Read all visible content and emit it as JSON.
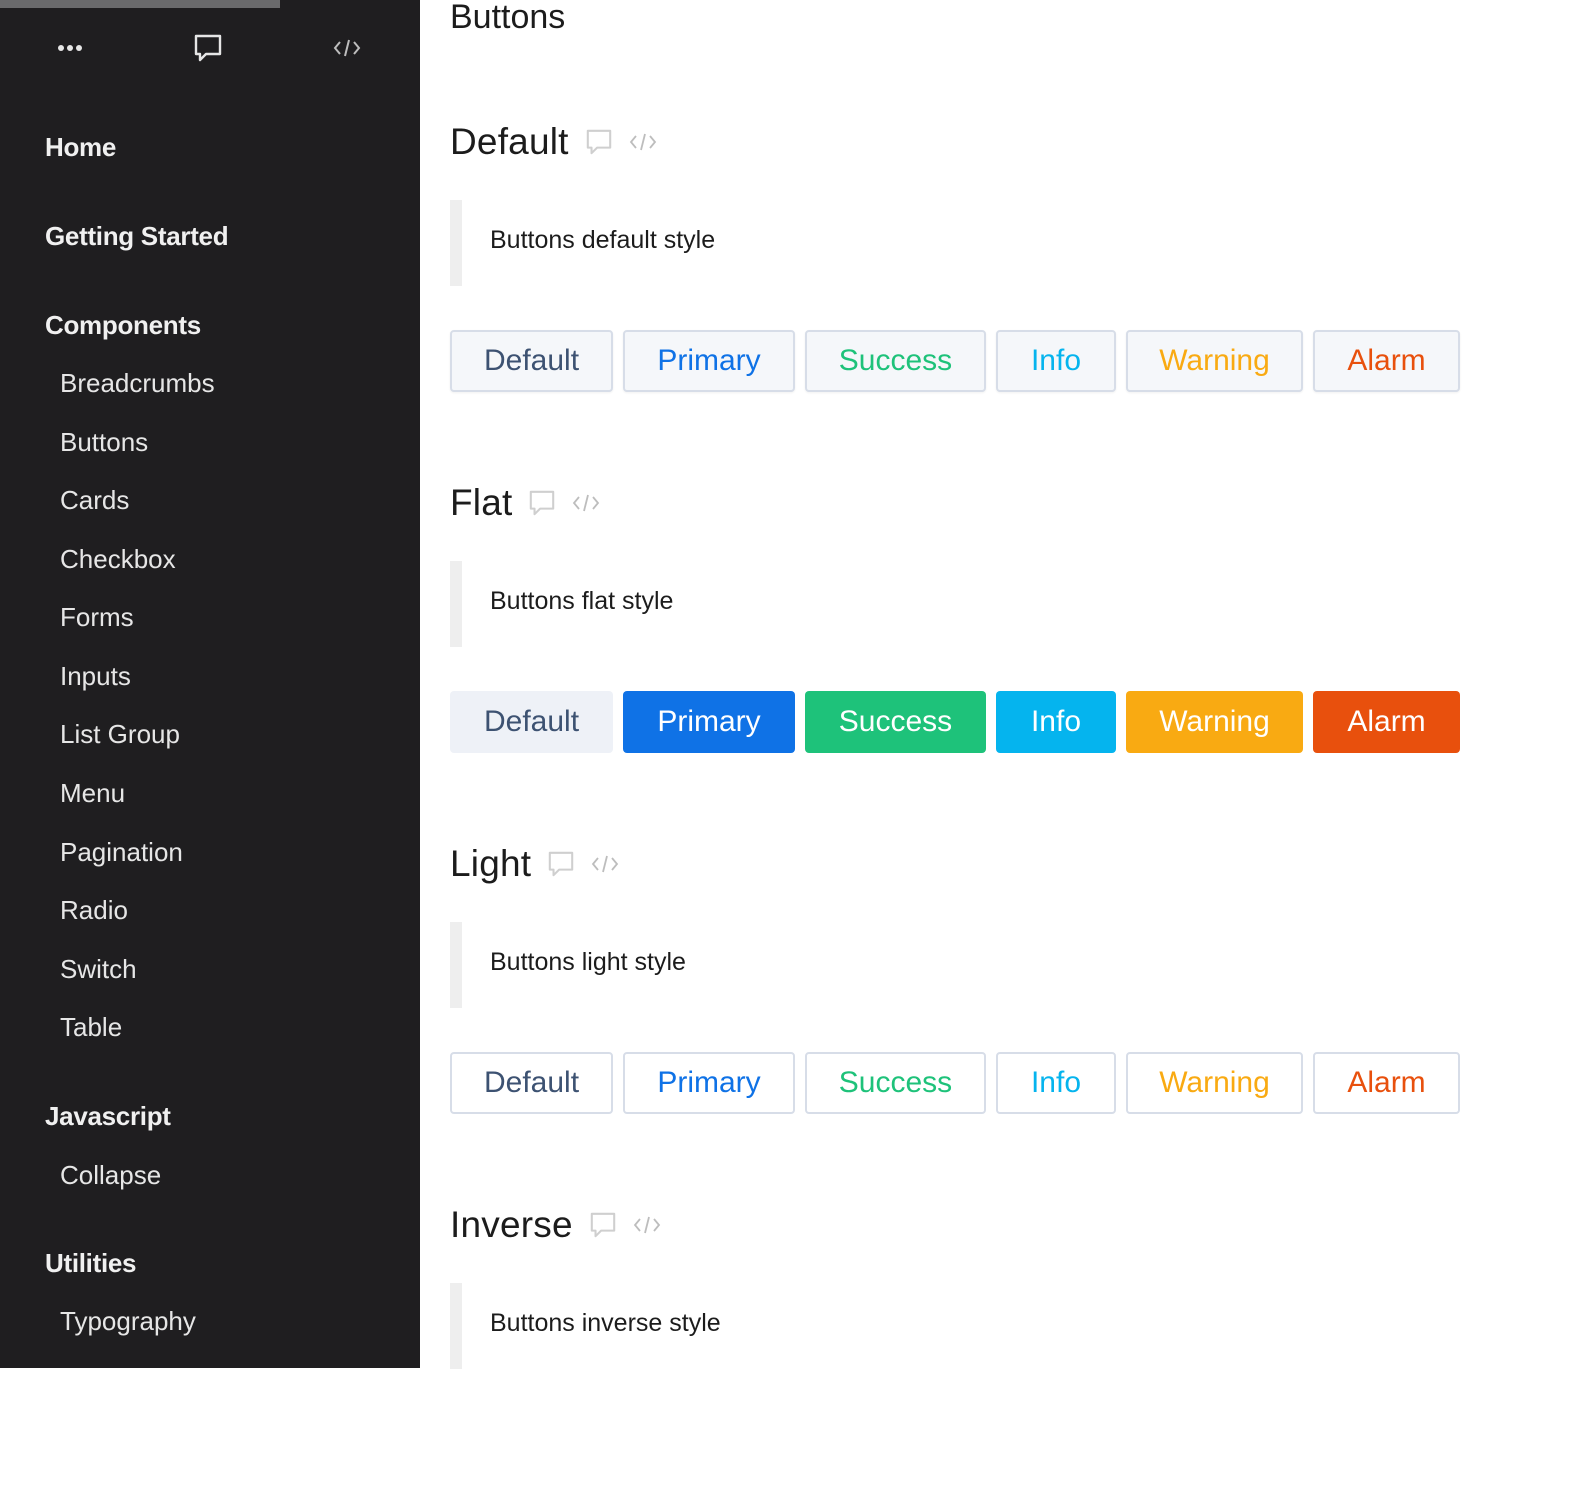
{
  "sidebar": {
    "toolbar": {
      "more_icon": "more-horizontal-icon",
      "comment_icon": "comment-icon",
      "code_icon": "code-icon"
    },
    "items": [
      {
        "label": "Home",
        "type": "section"
      },
      {
        "label": "Getting Started",
        "type": "section"
      },
      {
        "label": "Components",
        "type": "section"
      },
      {
        "label": "Breadcrumbs",
        "type": "link"
      },
      {
        "label": "Buttons",
        "type": "link"
      },
      {
        "label": "Cards",
        "type": "link"
      },
      {
        "label": "Checkbox",
        "type": "link"
      },
      {
        "label": "Forms",
        "type": "link"
      },
      {
        "label": "Inputs",
        "type": "link"
      },
      {
        "label": "List Group",
        "type": "link"
      },
      {
        "label": "Menu",
        "type": "link"
      },
      {
        "label": "Pagination",
        "type": "link"
      },
      {
        "label": "Radio",
        "type": "link"
      },
      {
        "label": "Switch",
        "type": "link"
      },
      {
        "label": "Table",
        "type": "link"
      },
      {
        "label": "Javascript",
        "type": "section"
      },
      {
        "label": "Collapse",
        "type": "link"
      },
      {
        "label": "Utilities",
        "type": "section"
      },
      {
        "label": "Typography",
        "type": "link"
      }
    ]
  },
  "main": {
    "page_title": "Buttons",
    "sections": [
      {
        "title": "Default",
        "description": "Buttons default style",
        "style": "default",
        "buttons": [
          "Default",
          "Primary",
          "Success",
          "Info",
          "Warning",
          "Alarm"
        ]
      },
      {
        "title": "Flat",
        "description": "Buttons flat style",
        "style": "flat",
        "buttons": [
          "Default",
          "Primary",
          "Success",
          "Info",
          "Warning",
          "Alarm"
        ]
      },
      {
        "title": "Light",
        "description": "Buttons light style",
        "style": "light",
        "buttons": [
          "Default",
          "Primary",
          "Success",
          "Info",
          "Warning",
          "Alarm"
        ]
      },
      {
        "title": "Inverse",
        "description": "Buttons inverse style",
        "style": "inverse",
        "buttons": []
      }
    ]
  },
  "colors": {
    "sidebar_bg": "#1f1e20",
    "default_text": "#3d5272",
    "default_flat_bg": "#eef1f7",
    "primary": "#0f72e6",
    "success": "#1ec27a",
    "info": "#05b4ee",
    "warning": "#f9aa12",
    "alarm": "#e8500d"
  }
}
